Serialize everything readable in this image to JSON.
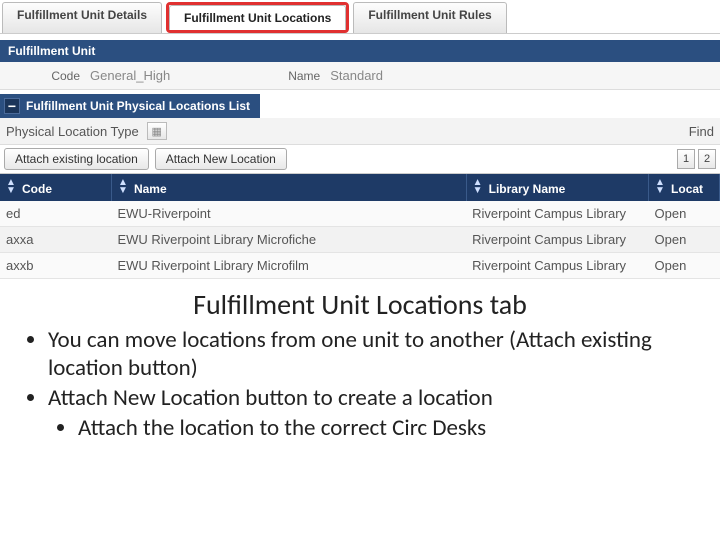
{
  "tabs": {
    "details": "Fulfillment Unit Details",
    "locations": "Fulfillment Unit Locations",
    "rules": "Fulfillment Unit Rules"
  },
  "section": {
    "title": "Fulfillment Unit"
  },
  "form": {
    "code_label": "Code",
    "code_value": "General_High",
    "name_label": "Name",
    "name_value": "Standard"
  },
  "sub": {
    "title": "Fulfillment Unit Physical Locations List"
  },
  "filter": {
    "label": "Physical Location Type",
    "find": "Find"
  },
  "actions": {
    "attach_existing": "Attach existing location",
    "attach_new": "Attach New Location"
  },
  "pager": {
    "p1": "1",
    "p2": "2"
  },
  "columns": {
    "code": "Code",
    "name": "Name",
    "library": "Library Name",
    "location": "Locat"
  },
  "rows": [
    {
      "code": "ed",
      "name": "EWU-Riverpoint",
      "library": "Riverpoint Campus Library",
      "loc": "Open"
    },
    {
      "code": "axxa",
      "name": "EWU Riverpoint Library Microfiche",
      "library": "Riverpoint Campus Library",
      "loc": "Open"
    },
    {
      "code": "axxb",
      "name": "EWU Riverpoint Library Microfilm",
      "library": "Riverpoint Campus Library",
      "loc": "Open"
    }
  ],
  "notes": {
    "heading": "Fulfillment Unit Locations tab",
    "b1": "You can move locations from one unit to another (Attach existing location button)",
    "b2": "Attach New Location button to create a location",
    "b2a": "Attach the location to the correct Circ Desks"
  }
}
